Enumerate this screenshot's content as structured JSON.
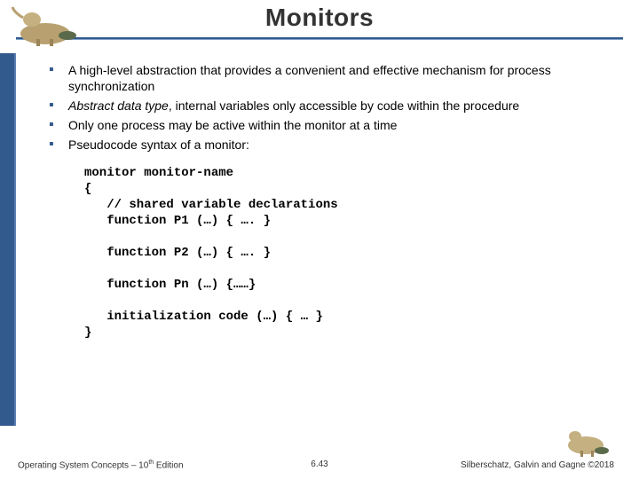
{
  "title": "Monitors",
  "bullets": [
    {
      "text": "A high-level abstraction that provides a convenient and effective mechanism for process synchronization"
    },
    {
      "prefix_italic": "Abstract data type",
      "rest": ", internal variables only accessible by code within the procedure"
    },
    {
      "text": "Only one process may be active within the monitor at a time"
    },
    {
      "text": "Pseudocode syntax of a monitor:"
    }
  ],
  "code": "monitor monitor-name\n{\n   // shared variable declarations\n   function P1 (…) { …. }\n\n   function P2 (…) { …. }\n\n   function Pn (…) {……}\n\n   initialization code (…) { … }\n}",
  "footer": {
    "left_a": "Operating System Concepts – 10",
    "left_sup": "th",
    "left_b": " Edition",
    "center": "6.43",
    "right": "Silberschatz, Galvin and Gagne ©2018"
  },
  "dino": {
    "top_alt": "dinosaur-illustration",
    "bottom_alt": "dinosaur-illustration"
  }
}
